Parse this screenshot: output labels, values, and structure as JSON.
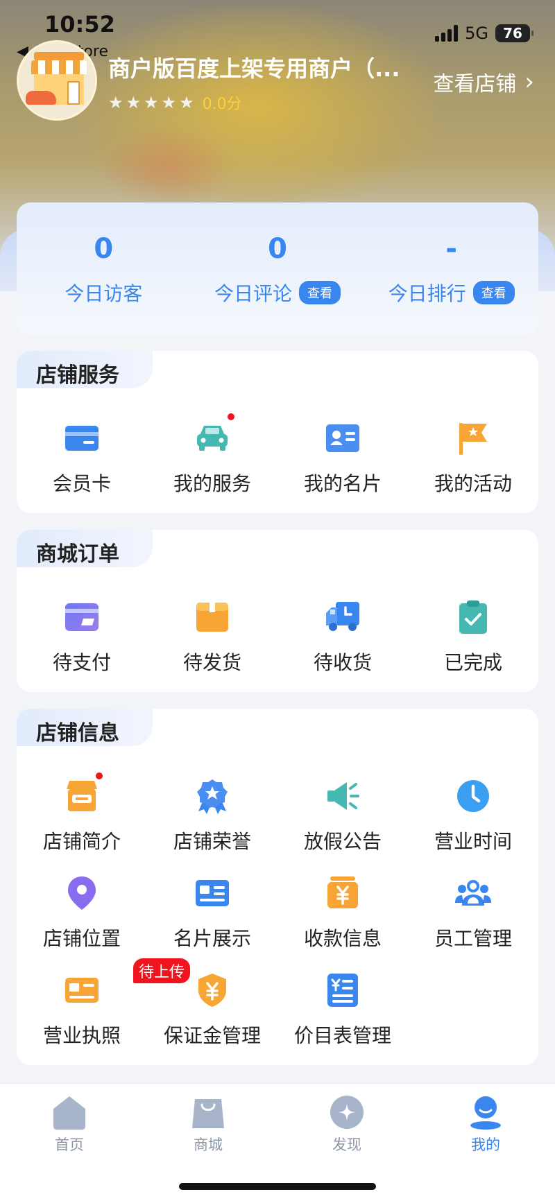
{
  "status_bar": {
    "time": "10:52",
    "back_app": "◀ App Store",
    "network": "5G",
    "battery": "76"
  },
  "shop": {
    "name": "商户版百度上架专用商户（...",
    "rating": "0.0分",
    "view_shop": "查看店铺"
  },
  "stats": [
    {
      "value": "0",
      "label": "今日访客",
      "action": ""
    },
    {
      "value": "0",
      "label": "今日评论",
      "action": "查看"
    },
    {
      "value": "-",
      "label": "今日排行",
      "action": "查看"
    }
  ],
  "store_services": {
    "title": "店铺服务",
    "items": [
      {
        "label": "会员卡",
        "icon": "member-card-icon"
      },
      {
        "label": "我的服务",
        "icon": "car-icon",
        "has_dot": true
      },
      {
        "label": "我的名片",
        "icon": "business-card-icon"
      },
      {
        "label": "我的活动",
        "icon": "flag-icon"
      }
    ]
  },
  "mall_orders": {
    "title": "商城订单",
    "items": [
      {
        "label": "待支付",
        "icon": "wallet-icon"
      },
      {
        "label": "待发货",
        "icon": "package-icon"
      },
      {
        "label": "待收货",
        "icon": "delivery-truck-icon"
      },
      {
        "label": "已完成",
        "icon": "clipboard-check-icon"
      }
    ]
  },
  "store_info": {
    "title": "店铺信息",
    "items": [
      {
        "label": "店铺简介",
        "icon": "store-icon",
        "has_dot": true
      },
      {
        "label": "店铺荣誉",
        "icon": "award-badge-icon"
      },
      {
        "label": "放假公告",
        "icon": "megaphone-icon"
      },
      {
        "label": "营业时间",
        "icon": "clock-icon"
      },
      {
        "label": "店铺位置",
        "icon": "location-pin-icon"
      },
      {
        "label": "名片展示",
        "icon": "id-card-icon"
      },
      {
        "label": "收款信息",
        "icon": "payment-yen-icon"
      },
      {
        "label": "员工管理",
        "icon": "staff-group-icon"
      },
      {
        "label": "营业执照",
        "icon": "license-icon",
        "tag": "待上传"
      },
      {
        "label": "保证金管理",
        "icon": "deposit-shield-icon"
      },
      {
        "label": "价目表管理",
        "icon": "price-list-icon"
      }
    ]
  },
  "tabbar": [
    {
      "label": "首页",
      "icon": "home-icon"
    },
    {
      "label": "商城",
      "icon": "shopping-bag-icon"
    },
    {
      "label": "发现",
      "icon": "discover-icon"
    },
    {
      "label": "我的",
      "icon": "profile-icon",
      "active": true
    }
  ],
  "colors": {
    "accent": "#3a86ef",
    "orange": "#f7a534",
    "teal": "#45b8b2",
    "red": "#f0141e",
    "purple": "#8a6cf0"
  }
}
